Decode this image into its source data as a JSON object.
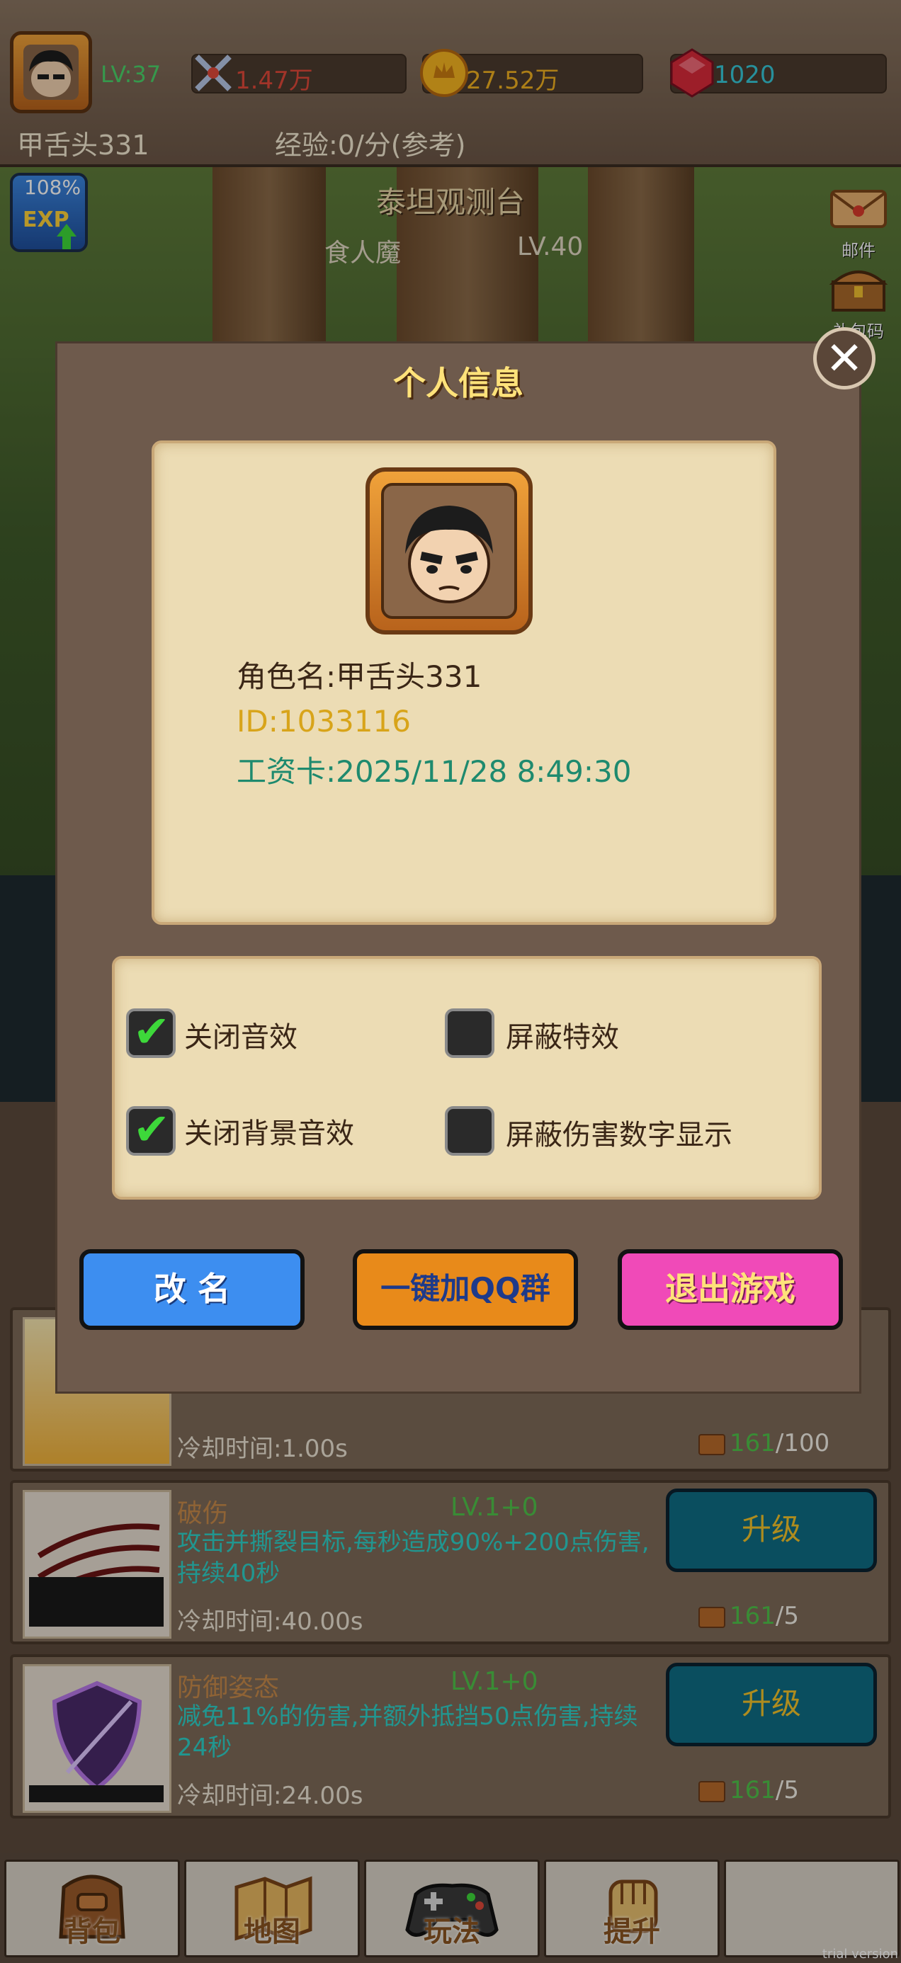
{
  "topbar": {
    "level": "LV:37",
    "power": "1.47万",
    "gold": "27.52万",
    "gems": "1020",
    "player_name": "甲舌头331",
    "exp_rate": "经验:0/分(参考)",
    "colors": {
      "power": "#e0483a",
      "gold": "#f0b020",
      "gems": "#36c8d8"
    }
  },
  "scene": {
    "location": "泰坦观测台",
    "enemy_name": "食人魔",
    "enemy_level": "LV.40",
    "exp_boost": "108%",
    "side_buttons": [
      {
        "label": "邮件",
        "icon": "mail-icon"
      },
      {
        "label": "礼包码",
        "icon": "gift-chest-icon"
      }
    ]
  },
  "dialog": {
    "title": "个人信息",
    "character_name": "角色名:甲舌头331",
    "player_id": "ID:1033116",
    "salary_card": "工资卡:2025/11/28 8:49:30",
    "options": [
      {
        "label": "关闭音效",
        "checked": true
      },
      {
        "label": "屏蔽特效",
        "checked": false
      },
      {
        "label": "关闭背景音效",
        "checked": true
      },
      {
        "label": "屏蔽伤害数字显示",
        "checked": false
      }
    ],
    "buttons": {
      "rename": "改 名",
      "join_qq": "一键加QQ群",
      "quit": "退出游戏"
    }
  },
  "skills": [
    {
      "name": "",
      "level": "",
      "desc": "",
      "cooldown": "冷却时间:1.00s",
      "cost_current": "161",
      "cost_required": "/100",
      "button": ""
    },
    {
      "name": "破伤",
      "level": "LV.1+0",
      "desc": "攻击并撕裂目标,每秒造成90%+200点伤害,持续40秒",
      "cooldown": "冷却时间:40.00s",
      "cost_current": "161",
      "cost_required": "/5",
      "button": "升级"
    },
    {
      "name": "防御姿态",
      "level": "LV.1+0",
      "desc": "减免11%的伤害,并额外抵挡50点伤害,持续24秒",
      "cooldown": "冷却时间:24.00s",
      "cost_current": "161",
      "cost_required": "/5",
      "button": "升级"
    }
  ],
  "nav": [
    {
      "label": "背包"
    },
    {
      "label": "地图"
    },
    {
      "label": "玩法"
    },
    {
      "label": "提升"
    },
    {
      "label": ""
    }
  ],
  "watermark": "trial version"
}
